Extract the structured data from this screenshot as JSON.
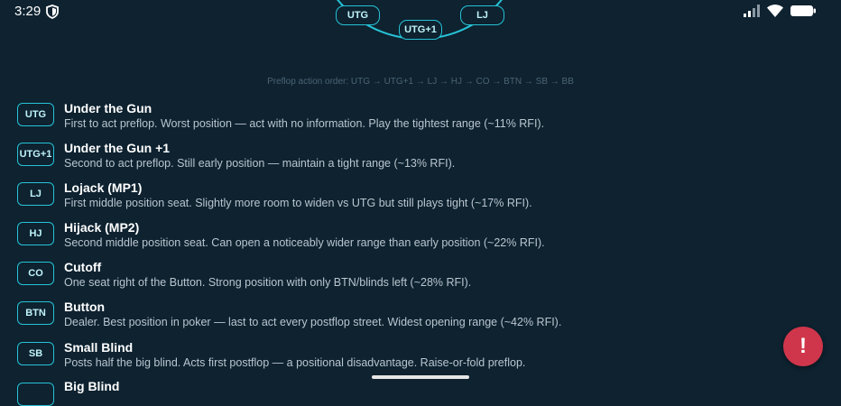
{
  "status_bar": {
    "time": "3:29",
    "icons": [
      "shield-icon",
      "signal-icon",
      "wifi-icon",
      "battery-icon"
    ]
  },
  "table": {
    "seats": [
      "UTG",
      "UTG+1",
      "LJ"
    ]
  },
  "action_order": "Preflop action order: UTG → UTG+1 → LJ → HJ → CO → BTN → SB → BB",
  "positions": [
    {
      "badge": "UTG",
      "title": "Under the Gun",
      "desc": "First to act preflop. Worst position — act with no information. Play the tightest range (~11% RFI)."
    },
    {
      "badge": "UTG+1",
      "title": "Under the Gun +1",
      "desc": "Second to act preflop. Still early position — maintain a tight range (~13% RFI)."
    },
    {
      "badge": "LJ",
      "title": "Lojack (MP1)",
      "desc": "First middle position seat. Slightly more room to widen vs UTG but still plays tight (~17% RFI)."
    },
    {
      "badge": "HJ",
      "title": "Hijack (MP2)",
      "desc": "Second middle position seat. Can open a noticeably wider range than early position (~22% RFI)."
    },
    {
      "badge": "CO",
      "title": "Cutoff",
      "desc": "One seat right of the Button. Strong position with only BTN/blinds left (~28% RFI)."
    },
    {
      "badge": "BTN",
      "title": "Button",
      "desc": "Dealer. Best position in poker — last to act every postflop street. Widest opening range (~42% RFI)."
    },
    {
      "badge": "SB",
      "title": "Small Blind",
      "desc": "Posts half the big blind. Acts first postflop — a positional disadvantage. Raise-or-fold preflop."
    },
    {
      "badge": "",
      "title": "Big Blind",
      "desc": ""
    }
  ],
  "fab": {
    "label": "!",
    "icon": "alert-icon"
  },
  "colors": {
    "background": "#0e2230",
    "accent": "#26c3d6",
    "fab": "#d0364b"
  }
}
